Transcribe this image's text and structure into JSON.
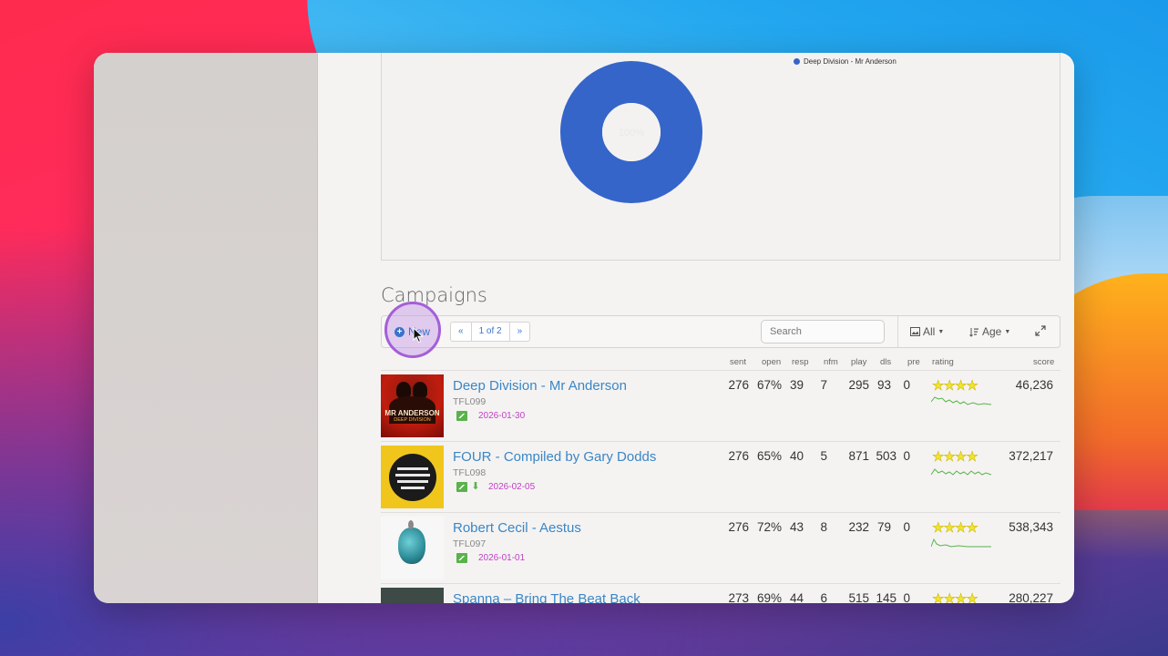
{
  "chart_data": {
    "type": "pie",
    "categories": [
      "Deep Division - Mr Anderson"
    ],
    "values": [
      100
    ],
    "slice_label": "100%",
    "colors": [
      "#3565c9"
    ],
    "legend": "top-right"
  },
  "campaigns": {
    "title": "Campaigns",
    "toolbar": {
      "new_label": "New",
      "pager_prev": "«",
      "pager_page": "1 of 2",
      "pager_next": "»",
      "search_placeholder": "Search",
      "filter_all": "All",
      "sort_age": "Age"
    },
    "columns": [
      "sent",
      "open",
      "resp",
      "nfm",
      "play",
      "dls",
      "pre",
      "rating",
      "score"
    ],
    "rows": [
      {
        "title": "Deep Division - Mr Anderson",
        "code": "TFL099",
        "date": "2026-01-30",
        "has_download": false,
        "sent": "276",
        "open": "67%",
        "resp": "39",
        "nfm": "7",
        "play": "295",
        "dls": "93",
        "pre": "0",
        "rating_stars": 4,
        "score": "46,236"
      },
      {
        "title": "FOUR - Compiled by Gary Dodds",
        "code": "TFL098",
        "date": "2026-02-05",
        "has_download": true,
        "sent": "276",
        "open": "65%",
        "resp": "40",
        "nfm": "5",
        "play": "871",
        "dls": "503",
        "pre": "0",
        "rating_stars": 4,
        "score": "372,217"
      },
      {
        "title": "Robert Cecil - Aestus",
        "code": "TFL097",
        "date": "2026-01-01",
        "has_download": false,
        "sent": "276",
        "open": "72%",
        "resp": "43",
        "nfm": "8",
        "play": "232",
        "dls": "79",
        "pre": "0",
        "rating_stars": 4,
        "score": "538,343"
      },
      {
        "title": "Spanna – Bring The Beat Back",
        "sent": "273",
        "open": "69%",
        "resp": "44",
        "nfm": "6",
        "play": "515",
        "dls": "145",
        "pre": "0",
        "rating_stars": 4,
        "score": "280,227"
      }
    ]
  },
  "thumbnails": {
    "row0_text_a": "MR ANDERSON",
    "row0_text_b": "DEEP DIVISION"
  },
  "colors": {
    "link": "#3b86c6",
    "date": "#c13fc5",
    "accent": "#3a73c9",
    "star": "#f1e332",
    "spark": "#59b34a"
  },
  "icons": [
    "plus-circle-icon",
    "cursor-icon",
    "image-icon",
    "download-icon",
    "expand-icon",
    "sort-icon",
    "picture-filter-icon",
    "caret-down-icon"
  ]
}
